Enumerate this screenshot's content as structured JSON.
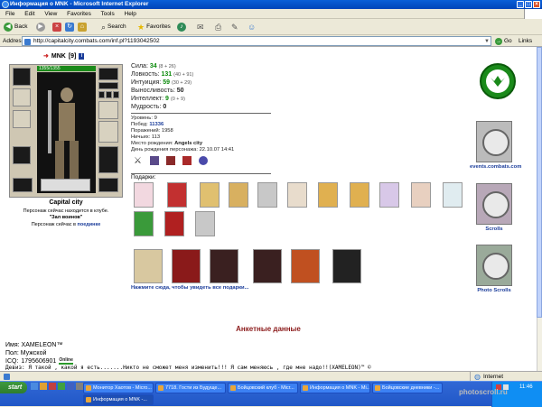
{
  "window": {
    "title": "Информация о MNK - Microsoft Internet Explorer"
  },
  "menu": [
    "File",
    "Edit",
    "View",
    "Favorites",
    "Tools",
    "Help"
  ],
  "toolbar": {
    "back": "Back",
    "search": "Search",
    "favorites": "Favorites"
  },
  "address": {
    "label": "Address",
    "url": "http://capitalcity.combats.com/inf.pl?1193042502",
    "go": "Go",
    "links": "Links"
  },
  "character": {
    "name": "MNK",
    "level": "[9]",
    "hp": "1355/1355",
    "city": "Capital city",
    "club_note": "Персонаж сейчас находится в клубе.",
    "room": "\"Зал воинов\"",
    "online_note": "Персонаж сейчас в",
    "online_place": "поединке"
  },
  "stats": [
    {
      "label": "Сила:",
      "value": "34",
      "extra": "(8 + 26)"
    },
    {
      "label": "Ловкость:",
      "value": "131",
      "extra": "(40 + 91)"
    },
    {
      "label": "Интуиция:",
      "value": "59",
      "extra": "(30 + 29)"
    },
    {
      "label": "Выносливость:",
      "value": "50",
      "extra": ""
    },
    {
      "label": "Интеллект:",
      "value": "9",
      "extra": "(0 + 9)"
    },
    {
      "label": "Мудрость:",
      "value": "0",
      "extra": ""
    }
  ],
  "info": [
    {
      "label": "Уровень:",
      "value": "9"
    },
    {
      "label": "Побед:",
      "value": "11336"
    },
    {
      "label": "Поражений:",
      "value": "1958"
    },
    {
      "label": "Ничьих:",
      "value": "113"
    },
    {
      "label": "Место рождения:",
      "value": "Angels city"
    },
    {
      "label": "День рождения персонажа:",
      "value": "22.10.07 14:41"
    }
  ],
  "gifts_label": "Подарки:",
  "gifts_link": "Нажмите сюда, чтобы увидеть все подарки...",
  "sidebar": {
    "events": "events.combats.com",
    "scrolls": "Scrolls",
    "photo": "Photo Scrolls"
  },
  "profile": {
    "heading": "Анкетные данные",
    "name_label": "Имя:",
    "name_value": "XAMELEON™",
    "gender_label": "Пол:",
    "gender_value": "Мужской",
    "icq_label": "ICQ:",
    "icq_value": "1795606901",
    "icq_status": "Online",
    "motto_label": "Девиз:",
    "motto_value": "Я такой , какой я есть.......Никто не сможет меня изменить!!! Я сам меняюсь , где мне надо!!(XAMELEON)™ ©"
  },
  "status": {
    "zone": "Internet"
  },
  "taskbar": {
    "start": "start",
    "tasks": [
      "Монитор Хаотов - Micro...",
      "7718. Гости из Будуще...",
      "Бойцовский клуб - Micr...",
      "Информация о MNK - Mi...",
      "Бойцовские дневники -...",
      "Информация о MNK -..."
    ],
    "clock": "11:46"
  },
  "watermark": "photoscroll.ru",
  "colors": {
    "title_blue": "#0a5fd8",
    "stat_green": "#0a8a0a",
    "heading_red": "#8b1a1a",
    "link_blue": "#1a3c9a"
  }
}
